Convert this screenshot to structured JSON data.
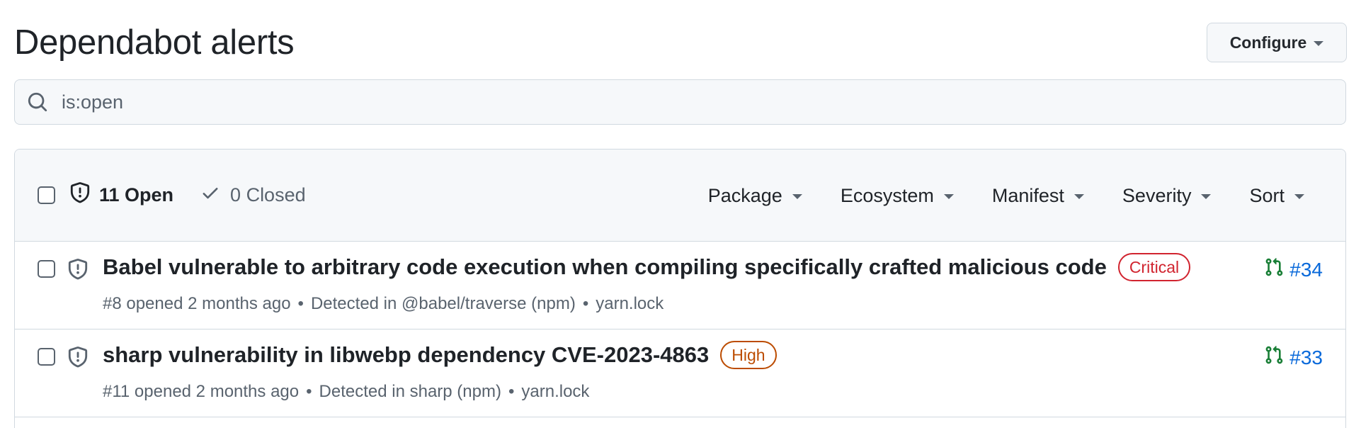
{
  "header": {
    "title": "Dependabot alerts",
    "configure_label": "Configure"
  },
  "search": {
    "value": "is:open"
  },
  "panel": {
    "open_label": "11 Open",
    "closed_label": "0 Closed",
    "filters": [
      {
        "label": "Package"
      },
      {
        "label": "Ecosystem"
      },
      {
        "label": "Manifest"
      },
      {
        "label": "Severity"
      },
      {
        "label": "Sort"
      }
    ]
  },
  "alerts": [
    {
      "title": "Babel vulnerable to arbitrary code execution when compiling specifically crafted malicious code",
      "severity": "Critical",
      "opened": "#8 opened 2 months ago",
      "detected": "Detected in @babel/traverse (npm)",
      "manifest": "yarn.lock",
      "pr": "#34"
    },
    {
      "title": "sharp vulnerability in libwebp dependency CVE-2023-4863",
      "severity": "High",
      "opened": "#11 opened 2 months ago",
      "detected": "Detected in sharp (npm)",
      "manifest": "yarn.lock",
      "pr": "#33"
    }
  ],
  "separator": "•",
  "colors": {
    "critical": "#d1242f",
    "high": "#bc4c00",
    "link": "#0969da",
    "pr_icon": "#1a7f37"
  }
}
